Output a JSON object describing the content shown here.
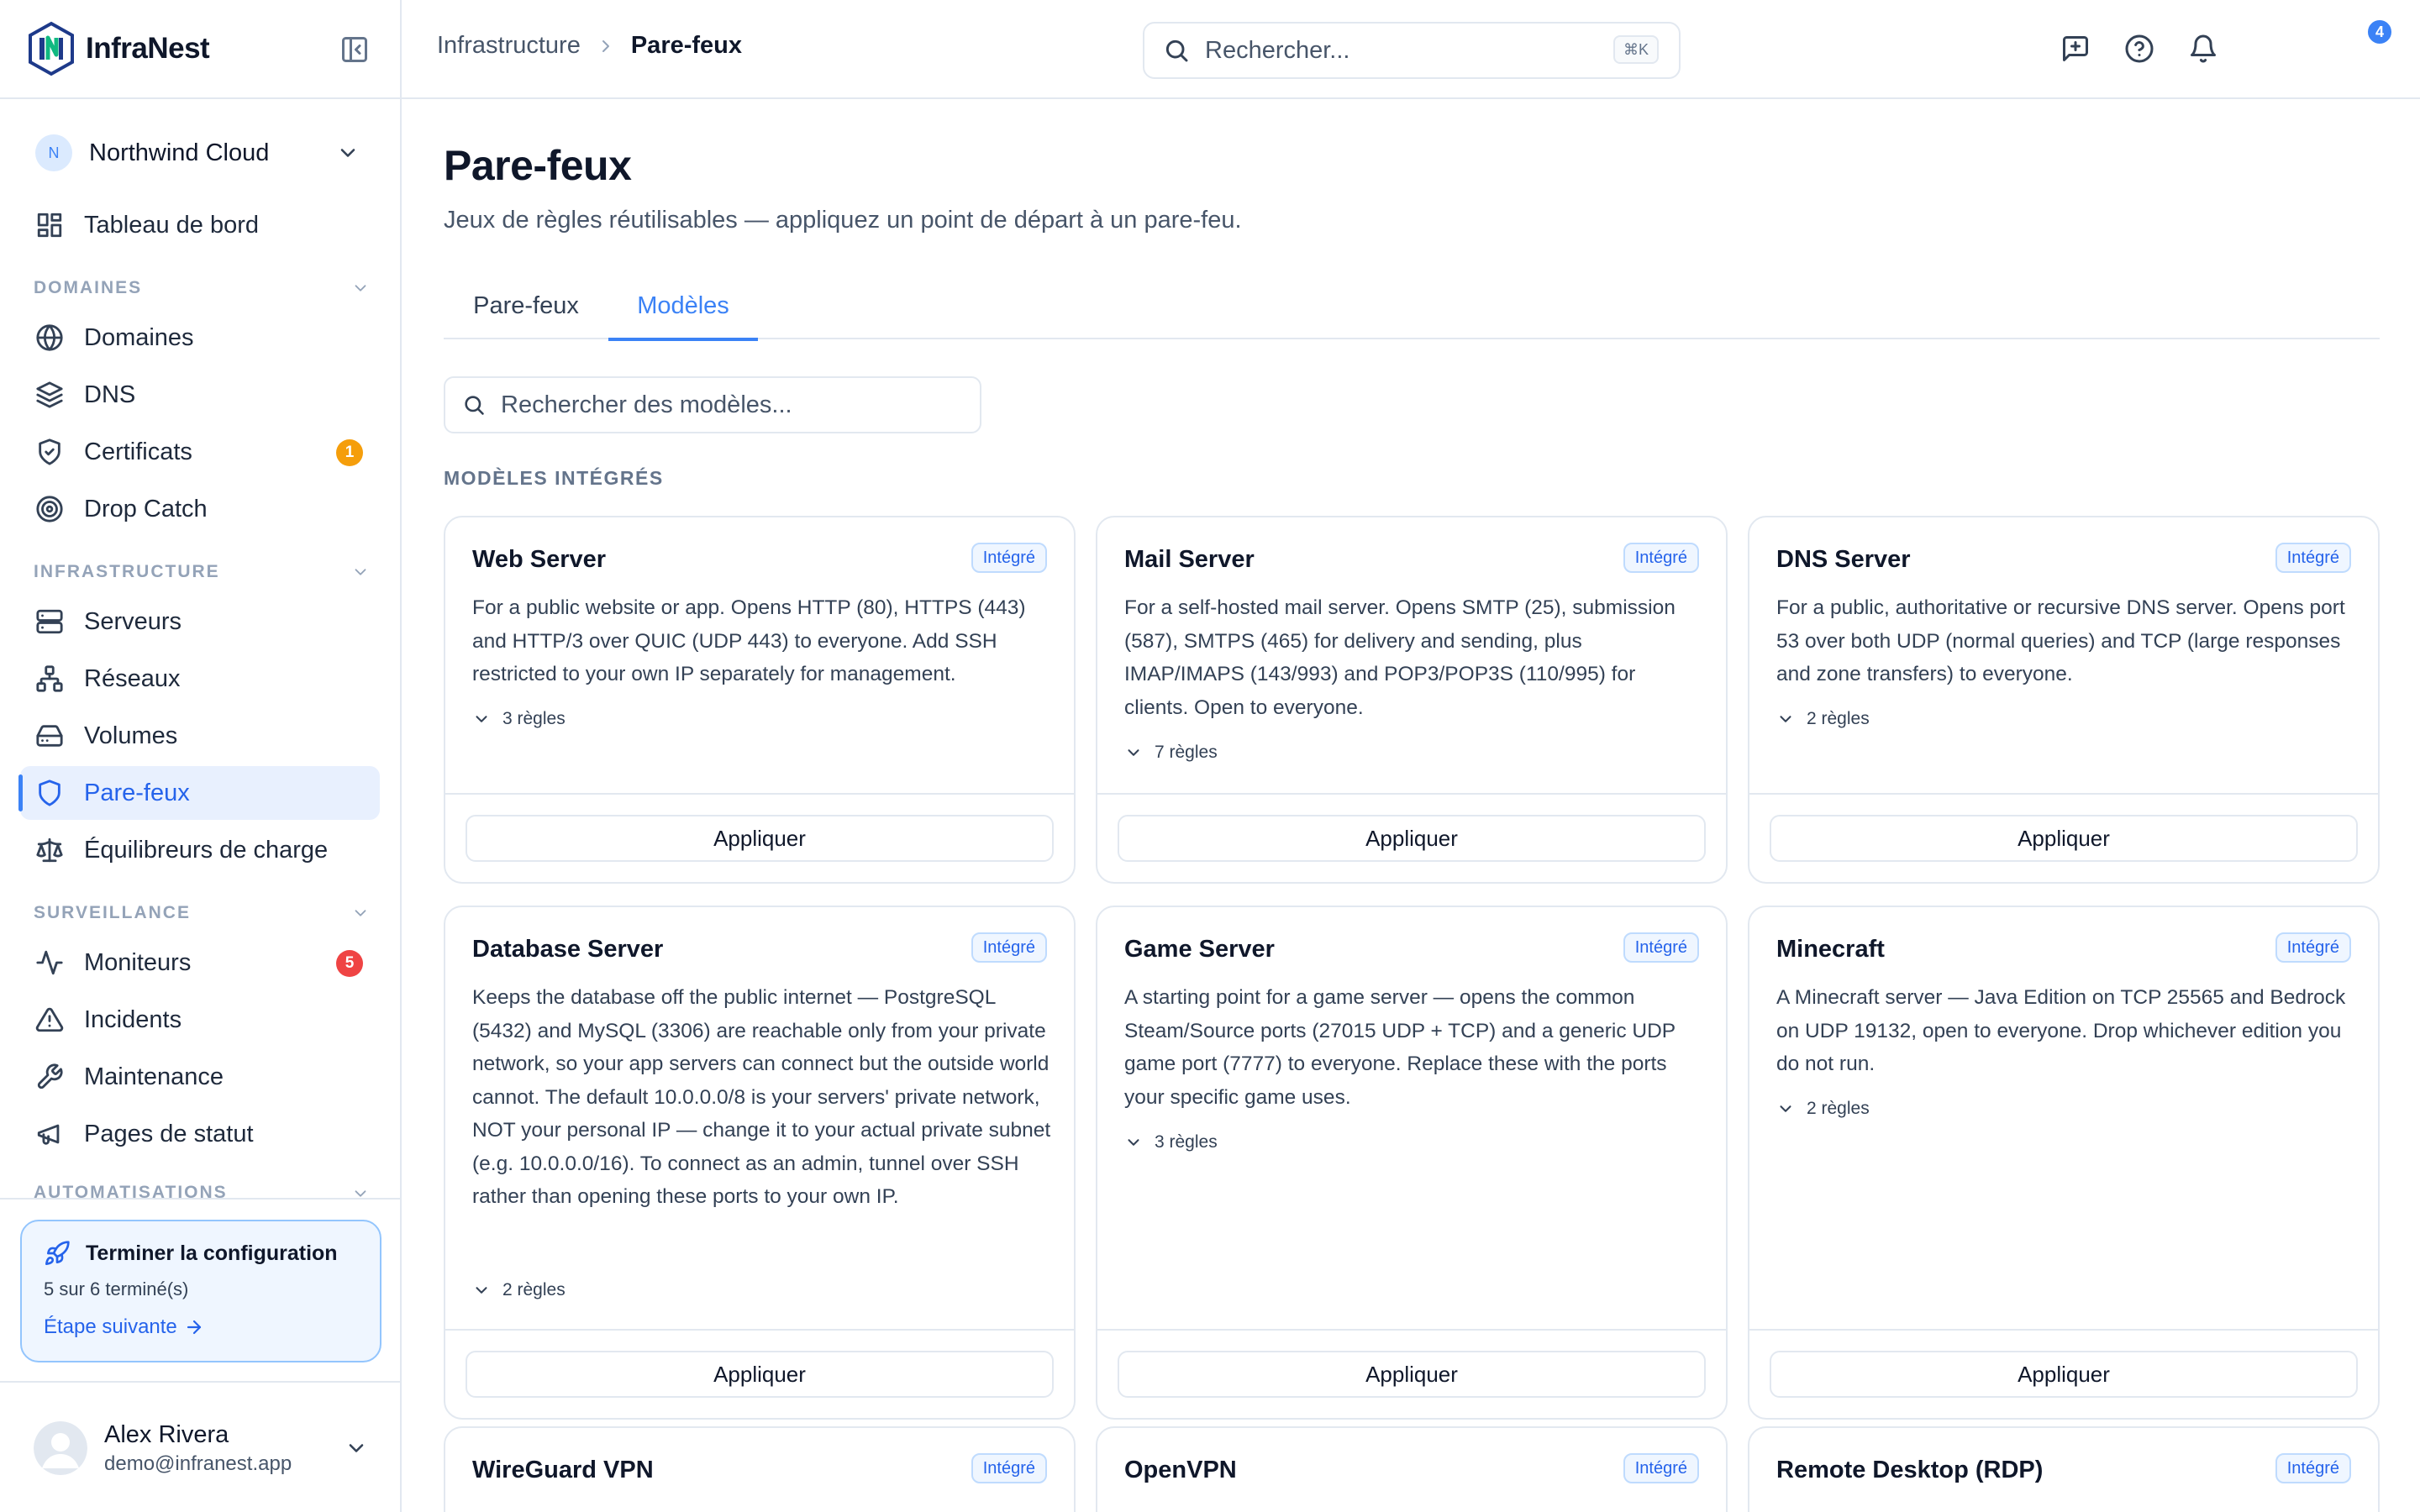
{
  "brand": {
    "name": "InfraNest"
  },
  "org": {
    "initial": "N",
    "name": "Northwind Cloud"
  },
  "sidebar": {
    "dashboard": "Tableau de bord",
    "sections": {
      "domains": "DOMAINES",
      "infrastructure": "INFRASTRUCTURE",
      "monitoring": "SURVEILLANCE",
      "automations": "AUTOMATISATIONS"
    },
    "items": {
      "domains": "Domaines",
      "dns": "DNS",
      "certificates": "Certificats",
      "drop_catch": "Drop Catch",
      "servers": "Serveurs",
      "networks": "Réseaux",
      "volumes": "Volumes",
      "firewalls": "Pare-feux",
      "load_balancers": "Équilibreurs de charge",
      "monitors": "Moniteurs",
      "incidents": "Incidents",
      "maintenance": "Maintenance",
      "status_pages": "Pages de statut"
    },
    "badges": {
      "certificates": "1",
      "monitors": "5"
    },
    "badge_colors": {
      "certificates": "#f59e0b",
      "monitors": "#ef4444"
    }
  },
  "setup": {
    "title": "Terminer la configuration",
    "progress": "5 sur 6 terminé(s)",
    "next": "Étape suivante"
  },
  "user": {
    "name": "Alex Rivera",
    "email": "demo@infranest.app"
  },
  "topbar": {
    "breadcrumb_parent": "Infrastructure",
    "breadcrumb_current": "Pare-feux",
    "search_placeholder": "Rechercher...",
    "search_shortcut": "⌘K",
    "notifications_count": "4"
  },
  "page": {
    "title": "Pare-feux",
    "subtitle": "Jeux de règles réutilisables — appliquez un point de départ à un pare-feu.",
    "tabs": [
      "Pare-feux",
      "Modèles"
    ],
    "active_tab": "Modèles",
    "template_search_placeholder": "Rechercher des modèles...",
    "section_heading": "MODÈLES INTÉGRÉS"
  },
  "templates": [
    {
      "title": "Web Server",
      "badge": "Intégré",
      "description": "For a public website or app. Opens HTTP (80), HTTPS (443) and HTTP/3 over QUIC (UDP 443) to everyone. Add SSH restricted to your own IP separately for management.",
      "rules": "3 règles",
      "action": "Appliquer"
    },
    {
      "title": "Mail Server",
      "badge": "Intégré",
      "description": "For a self-hosted mail server. Opens SMTP (25), submission (587), SMTPS (465) for delivery and sending, plus IMAP/IMAPS (143/993) and POP3/POP3S (110/995) for clients. Open to everyone.",
      "rules": "7 règles",
      "action": "Appliquer"
    },
    {
      "title": "DNS Server",
      "badge": "Intégré",
      "description": "For a public, authoritative or recursive DNS server. Opens port 53 over both UDP (normal queries) and TCP (large responses and zone transfers) to everyone.",
      "rules": "2 règles",
      "action": "Appliquer"
    },
    {
      "title": "Database Server",
      "badge": "Intégré",
      "description": "Keeps the database off the public internet — PostgreSQL (5432) and MySQL (3306) are reachable only from your private network, so your app servers can connect but the outside world cannot. The default 10.0.0.0/8 is your servers' private network, NOT your personal IP — change it to your actual private subnet (e.g. 10.0.0.0/16). To connect as an admin, tunnel over SSH rather than opening these ports to your own IP.",
      "rules": "2 règles",
      "action": "Appliquer"
    },
    {
      "title": "Game Server",
      "badge": "Intégré",
      "description": "A starting point for a game server — opens the common Steam/Source ports (27015 UDP + TCP) and a generic UDP game port (7777) to everyone. Replace these with the ports your specific game uses.",
      "rules": "3 règles",
      "action": "Appliquer"
    },
    {
      "title": "Minecraft",
      "badge": "Intégré",
      "description": "A Minecraft server — Java Edition on TCP 25565 and Bedrock on UDP 19132, open to everyone. Drop whichever edition you do not run.",
      "rules": "2 règles",
      "action": "Appliquer"
    },
    {
      "title": "WireGuard VPN",
      "badge": "Intégré"
    },
    {
      "title": "OpenVPN",
      "badge": "Intégré"
    },
    {
      "title": "Remote Desktop (RDP)",
      "badge": "Intégré"
    }
  ],
  "colors": {
    "accent": "#3b82f6",
    "active_nav_bg": "#e8f0fe",
    "border": "#e2e8f0"
  }
}
